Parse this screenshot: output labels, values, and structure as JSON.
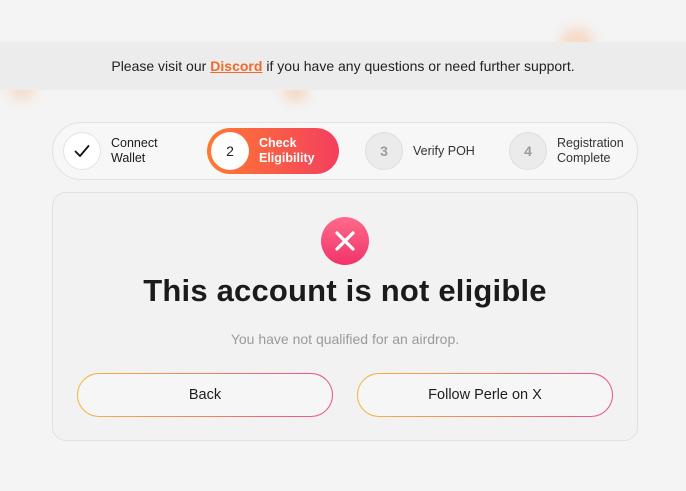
{
  "banner": {
    "prefix": "Please visit our",
    "link": "Discord",
    "suffix": "if you have any questions or need further support."
  },
  "steps": [
    {
      "marker": "check-icon",
      "label": "Connect\nWallet",
      "state": "done"
    },
    {
      "marker": "2",
      "label": "Check\nEligibility",
      "state": "active"
    },
    {
      "marker": "3",
      "label": "Verify POH",
      "state": "pending"
    },
    {
      "marker": "4",
      "label": "Registration\nComplete",
      "state": "pending"
    }
  ],
  "result": {
    "icon": "close-icon",
    "title": "This account is not eligible",
    "subtitle": "You have not qualified for an airdrop."
  },
  "buttons": {
    "back": "Back",
    "follow": "Follow Perle on X"
  },
  "colors": {
    "accent_orange": "#ff7a32",
    "accent_pink": "#f43f5e",
    "error": "#f0336b",
    "link": "#f06a2a"
  }
}
